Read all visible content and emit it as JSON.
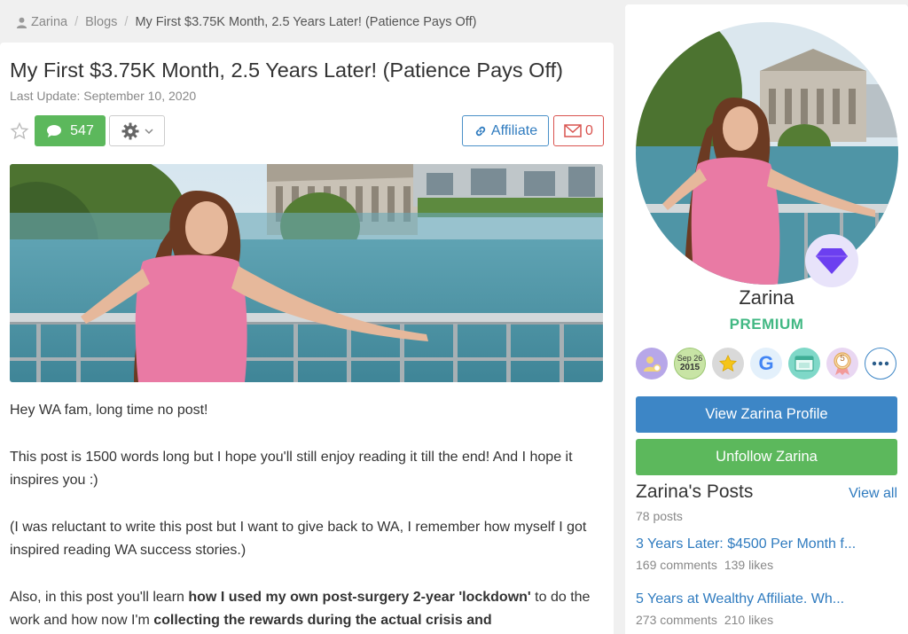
{
  "breadcrumb": {
    "user": "Zarina",
    "section": "Blogs",
    "current": "My First $3.75K Month, 2.5 Years Later! (Patience Pays Off)"
  },
  "post": {
    "title": "My First $3.75K Month, 2.5 Years Later! (Patience Pays Off)",
    "updated": "Last Update: September 10, 2020",
    "comments_count": "547",
    "affiliate_label": "Affiliate",
    "mail_count": "0",
    "hero_icon": "photo-of-woman-on-bridge",
    "paragraphs": {
      "p1": "Hey WA fam, long time no post!",
      "p2": "This post is 1500 words long but I hope you'll still enjoy reading it till the end! And I hope it inspires you :)",
      "p3": "(I was reluctant to write this post but I want to give back to WA, I remember how myself I got inspired reading WA success stories.)",
      "p4_a": "Also, in this post you'll learn ",
      "p4_b": "how I used my own post-surgery 2-year 'lockdown'",
      "p4_c": " to do the work and how now I'm ",
      "p4_d": "collecting the rewards during the actual crisis and"
    }
  },
  "sidebar": {
    "name": "Zarina",
    "rank": "PREMIUM",
    "badge_date_month": "Sep 26",
    "badge_date_year": "2015",
    "badge_number": "5",
    "badge_letter": "G",
    "view_profile": "View Zarina Profile",
    "unfollow": "Unfollow Zarina",
    "posts_title": "Zarina's Posts",
    "view_all": "View all",
    "posts_count": "78 posts",
    "posts": [
      {
        "title": "3 Years Later: $4500 Per Month f...",
        "comments": "169 comments",
        "likes": "139 likes"
      },
      {
        "title": "5 Years at Wealthy Affiliate. Wh...",
        "comments": "273 comments",
        "likes": "210 likes"
      }
    ]
  },
  "colors": {
    "green": "#5cb85c",
    "blue": "#3d86c6",
    "red": "#d9534f",
    "premium": "#41b883"
  }
}
